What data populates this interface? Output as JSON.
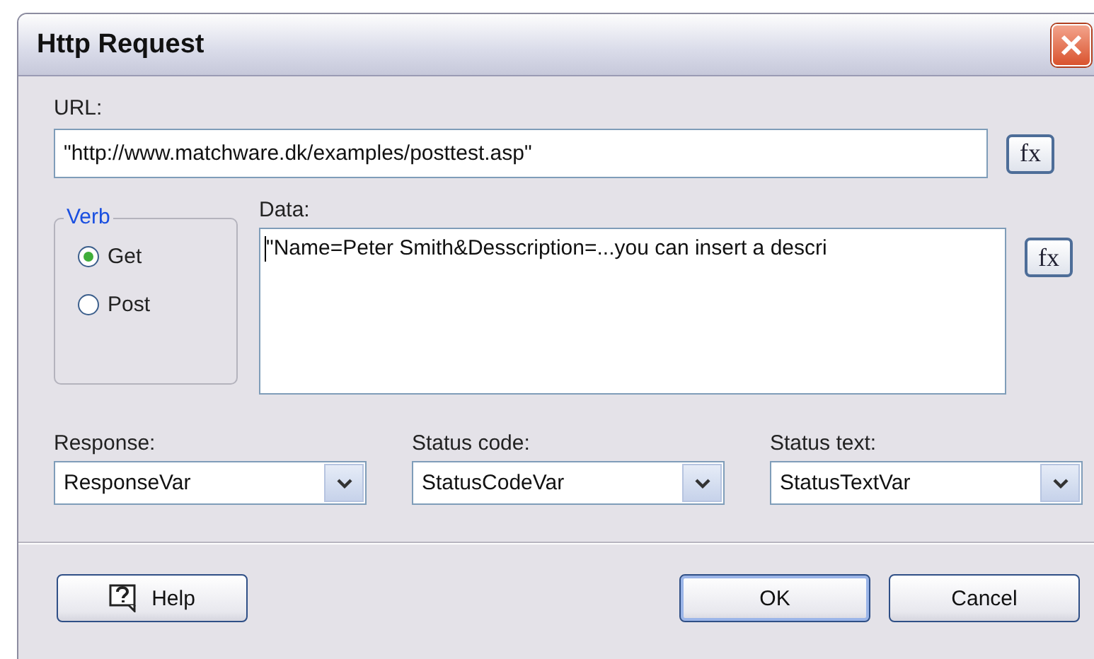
{
  "window": {
    "title": "Http Request"
  },
  "url": {
    "label": "URL:",
    "value": "\"http://www.matchware.dk/examples/posttest.asp\"",
    "fx_button": "fx"
  },
  "verb": {
    "label": "Verb",
    "options": [
      {
        "label": "Get",
        "selected": true
      },
      {
        "label": "Post",
        "selected": false
      }
    ]
  },
  "data": {
    "label": "Data:",
    "value": "\"Name=Peter Smith&Desscription=...you can insert a descri",
    "fx_button": "fx"
  },
  "dropdowns": [
    {
      "label": "Response:",
      "value": "ResponseVar"
    },
    {
      "label": "Status code:",
      "value": "StatusCodeVar"
    },
    {
      "label": "Status text:",
      "value": "StatusTextVar"
    }
  ],
  "buttons": [
    {
      "label": "Help",
      "kind": "help"
    },
    {
      "label": "OK",
      "kind": "default"
    },
    {
      "label": "Cancel",
      "kind": "normal"
    }
  ]
}
